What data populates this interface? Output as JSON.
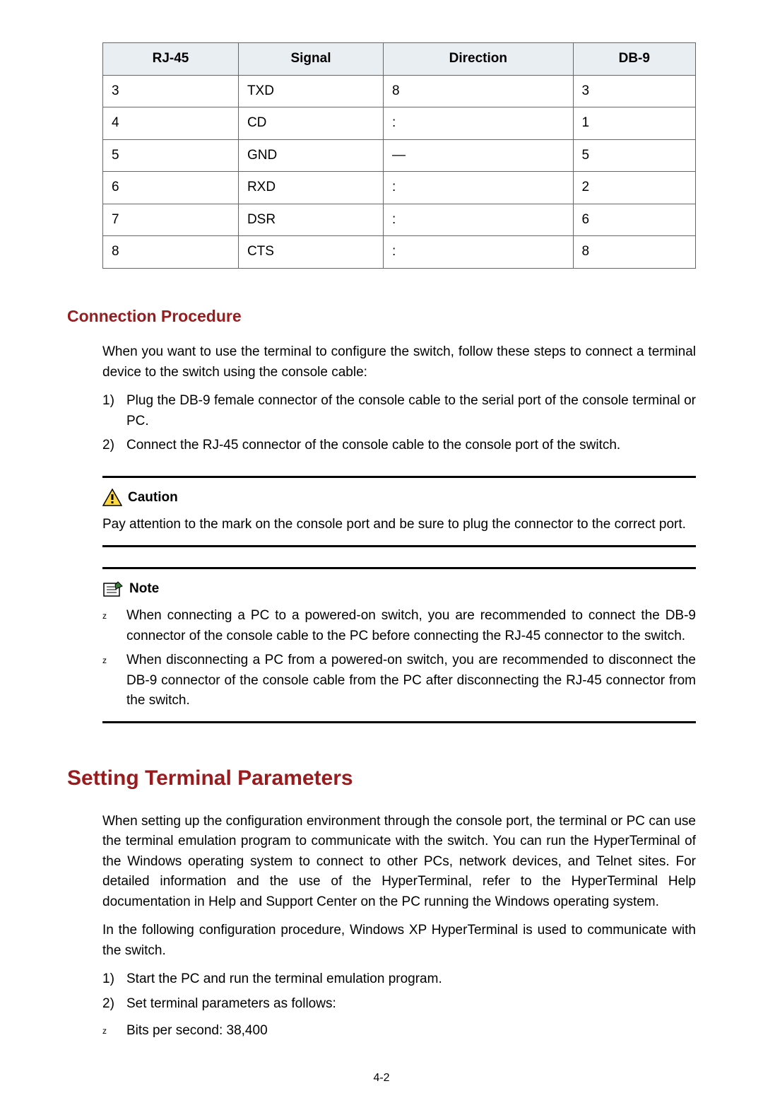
{
  "table": {
    "headers": [
      "RJ-45",
      "Signal",
      "Direction",
      "DB-9"
    ],
    "rows": [
      [
        "3",
        "TXD",
        "8",
        "3"
      ],
      [
        "4",
        "CD",
        ":",
        "1"
      ],
      [
        "5",
        "GND",
        "—",
        "5"
      ],
      [
        "6",
        "RXD",
        ":",
        "2"
      ],
      [
        "7",
        "DSR",
        ":",
        "6"
      ],
      [
        "8",
        "CTS",
        ":",
        "8"
      ]
    ]
  },
  "sec_conn": {
    "heading": "Connection Procedure",
    "intro": "When you want to use the terminal to configure the switch, follow these steps to connect a terminal device to the switch using the console cable:",
    "steps": [
      "Plug the DB-9 female connector of the console cable to the serial port of the console terminal or PC.",
      "Connect the RJ-45 connector of the console cable to the console port of the switch."
    ]
  },
  "caution": {
    "label": "Caution",
    "text": "Pay attention to the mark on the console port and be sure to plug the connector to the correct port."
  },
  "note": {
    "label": "Note",
    "bullets": [
      "When connecting a PC to a powered-on switch, you are recommended to connect the DB-9 connector of the console cable to the PC before connecting the RJ-45 connector to the switch.",
      "When disconnecting a PC from a powered-on switch, you are recommended to disconnect the DB-9 connector of the console cable from the PC after disconnecting the RJ-45 connector from the switch."
    ]
  },
  "sec_term": {
    "heading": "Setting Terminal Parameters",
    "p1": "When setting up the configuration environment through the console port, the terminal or PC can use the terminal emulation program to communicate with the switch. You can run the HyperTerminal of the Windows operating system to connect to other PCs, network devices, and Telnet sites. For detailed information and the use of the HyperTerminal, refer to the HyperTerminal Help documentation in Help and Support Center on the PC running the Windows operating system.",
    "p2": "In the following configuration procedure, Windows XP HyperTerminal is used to communicate with the switch.",
    "steps": [
      "Start the PC and run the terminal emulation program.",
      "Set terminal parameters as follows:"
    ],
    "params": [
      "Bits per second: 38,400"
    ]
  },
  "page_number": "4-2"
}
